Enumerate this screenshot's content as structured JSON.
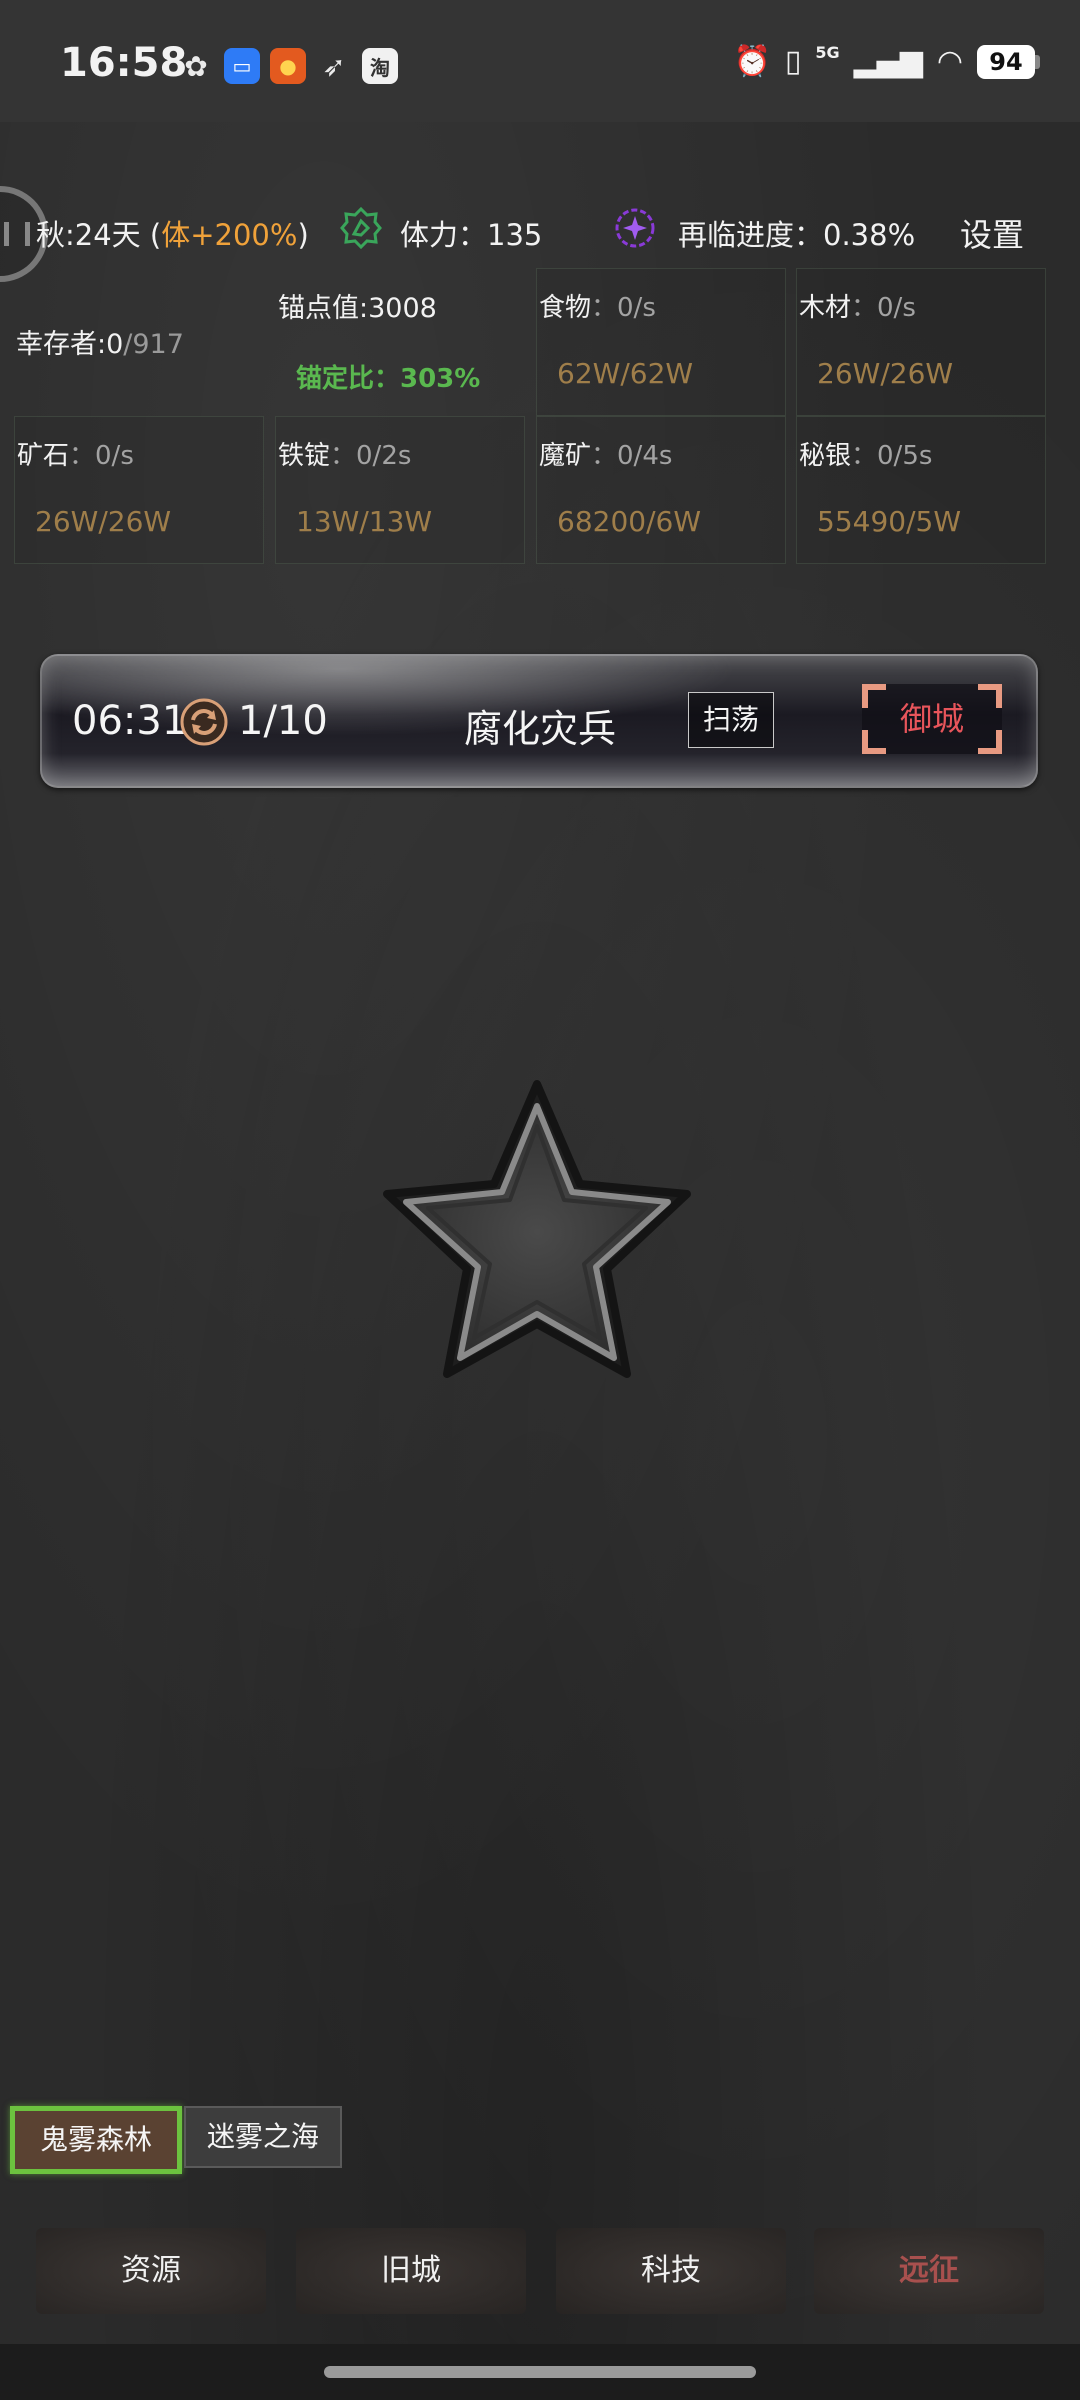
{
  "status_bar": {
    "time": "16:58",
    "network": "5G",
    "battery": "94",
    "app_icons": [
      "wechat-icon",
      "message-icon",
      "gov-app-icon",
      "bird-icon",
      "taobao-icon"
    ],
    "taobao_glyph": "淘"
  },
  "top_info": {
    "season": "秋:24天 (",
    "season_bonus": "体+200%",
    "season_close": ")",
    "stamina": "体力：135",
    "progress": "再临进度：0.38%",
    "settings": "设置"
  },
  "stats": {
    "survivors_label": "幸存者:0",
    "survivors_max": "/917",
    "anchor_value": "锚点值:3008",
    "anchor_ratio": "锚定比：303%"
  },
  "resources": [
    {
      "label": "食物",
      "rate": "：0/s",
      "amount": "62W/62W"
    },
    {
      "label": "木材",
      "rate": "：0/s",
      "amount": "26W/26W"
    },
    {
      "label": "矿石",
      "rate": "：0/s",
      "amount": "26W/26W"
    },
    {
      "label": "铁锭",
      "rate": "：0/2s",
      "amount": "13W/13W"
    },
    {
      "label": "魔矿",
      "rate": "：0/4s",
      "amount": "68200/6W"
    },
    {
      "label": "秘银",
      "rate": "：0/5s",
      "amount": "55490/5W"
    }
  ],
  "event": {
    "timer": "06:31",
    "count": "1/10",
    "name": "腐化灾兵",
    "sweep_label": "扫荡",
    "defend_label": "御城"
  },
  "map_tabs": [
    {
      "label": "鬼雾森林",
      "active": true
    },
    {
      "label": "迷雾之海",
      "active": false
    }
  ],
  "bottom_nav": [
    {
      "label": "资源"
    },
    {
      "label": "旧城"
    },
    {
      "label": "科技"
    },
    {
      "label": "远征"
    }
  ],
  "colors": {
    "accent_orange": "#f0a23a",
    "anchor_green": "#5ab84f",
    "resource_amount": "#9f7e4a",
    "defend_red": "#e8555b",
    "active_tab_border": "#6cc23f",
    "expedition_red": "#a8504e"
  }
}
